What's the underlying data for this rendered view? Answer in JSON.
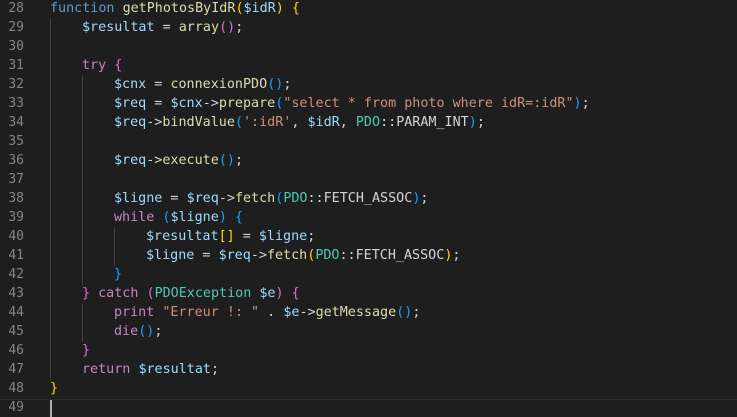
{
  "editor": {
    "lines": [
      {
        "n": "28",
        "tokens": [
          [
            "kw",
            "function "
          ],
          [
            "fn",
            "getPhotosByIdR"
          ],
          [
            "b1",
            "("
          ],
          [
            "var",
            "$idR"
          ],
          [
            "b1",
            ")"
          ],
          [
            "op",
            " "
          ],
          [
            "b1",
            "{"
          ]
        ]
      },
      {
        "n": "29",
        "tokens": [
          [
            "var",
            "$resultat"
          ],
          [
            "op",
            " = "
          ],
          [
            "fn",
            "array"
          ],
          [
            "b2",
            "()"
          ],
          [
            "op",
            ";"
          ]
        ]
      },
      {
        "n": "30",
        "tokens": []
      },
      {
        "n": "31",
        "tokens": [
          [
            "ctl",
            "try"
          ],
          [
            "op",
            " "
          ],
          [
            "b2",
            "{"
          ]
        ]
      },
      {
        "n": "32",
        "tokens": [
          [
            "var",
            "$cnx"
          ],
          [
            "op",
            " = "
          ],
          [
            "fn",
            "connexionPDO"
          ],
          [
            "b3",
            "()"
          ],
          [
            "op",
            ";"
          ]
        ]
      },
      {
        "n": "33",
        "tokens": [
          [
            "var",
            "$req"
          ],
          [
            "op",
            " = "
          ],
          [
            "var",
            "$cnx"
          ],
          [
            "op",
            "->"
          ],
          [
            "fn",
            "prepare"
          ],
          [
            "b3",
            "("
          ],
          [
            "str",
            "\"select * from photo where idR=:idR\""
          ],
          [
            "b3",
            ")"
          ],
          [
            "op",
            ";"
          ]
        ]
      },
      {
        "n": "34",
        "tokens": [
          [
            "var",
            "$req"
          ],
          [
            "op",
            "->"
          ],
          [
            "fn",
            "bindValue"
          ],
          [
            "b3",
            "("
          ],
          [
            "str",
            "':idR'"
          ],
          [
            "op",
            ", "
          ],
          [
            "var",
            "$idR"
          ],
          [
            "op",
            ", "
          ],
          [
            "cls",
            "PDO"
          ],
          [
            "op",
            "::"
          ],
          [
            "con",
            "PARAM_INT"
          ],
          [
            "b3",
            ")"
          ],
          [
            "op",
            ";"
          ]
        ]
      },
      {
        "n": "35",
        "tokens": []
      },
      {
        "n": "36",
        "tokens": [
          [
            "var",
            "$req"
          ],
          [
            "op",
            "->"
          ],
          [
            "fn",
            "execute"
          ],
          [
            "b3",
            "()"
          ],
          [
            "op",
            ";"
          ]
        ]
      },
      {
        "n": "37",
        "tokens": []
      },
      {
        "n": "38",
        "tokens": [
          [
            "var",
            "$ligne"
          ],
          [
            "op",
            " = "
          ],
          [
            "var",
            "$req"
          ],
          [
            "op",
            "->"
          ],
          [
            "fn",
            "fetch"
          ],
          [
            "b3",
            "("
          ],
          [
            "cls",
            "PDO"
          ],
          [
            "op",
            "::"
          ],
          [
            "con",
            "FETCH_ASSOC"
          ],
          [
            "b3",
            ")"
          ],
          [
            "op",
            ";"
          ]
        ]
      },
      {
        "n": "39",
        "tokens": [
          [
            "ctl",
            "while"
          ],
          [
            "op",
            " "
          ],
          [
            "b3",
            "("
          ],
          [
            "var",
            "$ligne"
          ],
          [
            "b3",
            ")"
          ],
          [
            "op",
            " "
          ],
          [
            "b3",
            "{"
          ]
        ]
      },
      {
        "n": "40",
        "tokens": [
          [
            "var",
            "$resultat"
          ],
          [
            "b1",
            "[]"
          ],
          [
            "op",
            " = "
          ],
          [
            "var",
            "$ligne"
          ],
          [
            "op",
            ";"
          ]
        ]
      },
      {
        "n": "41",
        "tokens": [
          [
            "var",
            "$ligne"
          ],
          [
            "op",
            " = "
          ],
          [
            "var",
            "$req"
          ],
          [
            "op",
            "->"
          ],
          [
            "fn",
            "fetch"
          ],
          [
            "b1",
            "("
          ],
          [
            "cls",
            "PDO"
          ],
          [
            "op",
            "::"
          ],
          [
            "con",
            "FETCH_ASSOC"
          ],
          [
            "b1",
            ")"
          ],
          [
            "op",
            ";"
          ]
        ]
      },
      {
        "n": "42",
        "tokens": [
          [
            "b3",
            "}"
          ]
        ]
      },
      {
        "n": "43",
        "tokens": [
          [
            "b2",
            "}"
          ],
          [
            "op",
            " "
          ],
          [
            "ctl",
            "catch"
          ],
          [
            "op",
            " "
          ],
          [
            "b2",
            "("
          ],
          [
            "cls",
            "PDOException"
          ],
          [
            "op",
            " "
          ],
          [
            "var",
            "$e"
          ],
          [
            "b2",
            ")"
          ],
          [
            "op",
            " "
          ],
          [
            "b2",
            "{"
          ]
        ]
      },
      {
        "n": "44",
        "tokens": [
          [
            "ctl",
            "print"
          ],
          [
            "op",
            " "
          ],
          [
            "str",
            "\"Erreur !: \""
          ],
          [
            "op",
            " . "
          ],
          [
            "var",
            "$e"
          ],
          [
            "op",
            "->"
          ],
          [
            "fn",
            "getMessage"
          ],
          [
            "b3",
            "()"
          ],
          [
            "op",
            ";"
          ]
        ]
      },
      {
        "n": "45",
        "tokens": [
          [
            "ctl",
            "die"
          ],
          [
            "b3",
            "()"
          ],
          [
            "op",
            ";"
          ]
        ]
      },
      {
        "n": "46",
        "tokens": [
          [
            "b2",
            "}"
          ]
        ]
      },
      {
        "n": "47",
        "tokens": [
          [
            "ctl",
            "return"
          ],
          [
            "op",
            " "
          ],
          [
            "var",
            "$resultat"
          ],
          [
            "op",
            ";"
          ]
        ]
      },
      {
        "n": "48",
        "tokens": [
          [
            "b1",
            "}"
          ]
        ]
      },
      {
        "n": "49",
        "tokens": []
      }
    ]
  }
}
